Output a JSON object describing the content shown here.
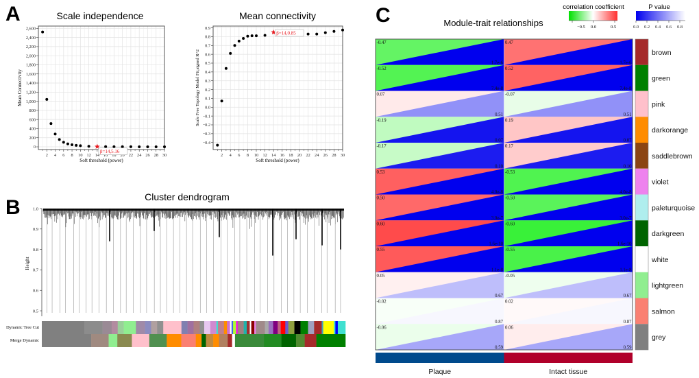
{
  "panels": {
    "a": "A",
    "b": "B",
    "c": "C"
  },
  "chart_data": [
    {
      "type": "scatter",
      "id": "scale-independence",
      "title": "Scale independence",
      "xlabel": "Soft threshold (power)",
      "ylabel": "Mean Connectivity",
      "xlim": [
        0,
        30
      ],
      "ylim": [
        -60,
        2650
      ],
      "xticks": [
        2,
        4,
        6,
        8,
        10,
        12,
        14,
        16,
        18,
        20,
        22,
        24,
        26,
        28,
        30
      ],
      "yticks": [
        0,
        200,
        400,
        600,
        800,
        1000,
        1200,
        1400,
        1600,
        1800,
        2000,
        2200,
        2400,
        2600
      ],
      "ytick_labels": [
        "0",
        "200",
        "400",
        "600",
        "800",
        "1,000",
        "1,200",
        "1,400",
        "1,600",
        "1,800",
        "2,000",
        "2,200",
        "2,400",
        "2,600"
      ],
      "grid": true,
      "x": [
        1,
        2,
        3,
        4,
        5,
        6,
        7,
        8,
        9,
        10,
        12,
        14,
        16,
        18,
        20,
        22,
        24,
        26,
        28,
        30
      ],
      "y": [
        2520,
        1040,
        510,
        280,
        160,
        100,
        65,
        45,
        32,
        25,
        12,
        5.16,
        4,
        3,
        2,
        2,
        1,
        1,
        1,
        1
      ],
      "highlight": {
        "x": 14,
        "y": 5.16,
        "label": "β=14,5.16",
        "color": "#e8191f"
      }
    },
    {
      "type": "scatter",
      "id": "mean-connectivity",
      "title": "Mean connectivity",
      "xlabel": "Soft threshold (power)",
      "ylabel": "Scale Free Topology Model Fit,signed R^2",
      "xlim": [
        0,
        30
      ],
      "ylim": [
        -0.48,
        0.92
      ],
      "xticks": [
        2,
        4,
        6,
        8,
        10,
        12,
        14,
        16,
        18,
        20,
        22,
        24,
        26,
        28,
        30
      ],
      "yticks": [
        -0.4,
        -0.3,
        -0.2,
        -0.1,
        0.0,
        0.1,
        0.2,
        0.3,
        0.4,
        0.5,
        0.6,
        0.7,
        0.8,
        0.9
      ],
      "ytick_labels": [
        "−0.4",
        "−0.3",
        "−0.2",
        "−0.1",
        "0.0",
        "0.1",
        "0.2",
        "0.3",
        "0.4",
        "0.5",
        "0.6",
        "0.7",
        "0.8",
        "0.9"
      ],
      "grid": true,
      "x": [
        1,
        2,
        3,
        4,
        5,
        6,
        7,
        8,
        9,
        10,
        12,
        14,
        16,
        18,
        20,
        22,
        24,
        26,
        28,
        30
      ],
      "y": [
        -0.43,
        0.07,
        0.44,
        0.61,
        0.7,
        0.75,
        0.78,
        0.805,
        0.81,
        0.81,
        0.815,
        0.85,
        0.85,
        0.845,
        0.825,
        0.83,
        0.83,
        0.845,
        0.86,
        0.875
      ],
      "highlight": {
        "x": 14,
        "y": 0.85,
        "label": "β=14,0.85",
        "color": "#e8191f"
      }
    },
    {
      "type": "dendrogram",
      "id": "cluster-dendrogram",
      "title": "Cluster dendrogram",
      "ylabel": "Height",
      "ylim": [
        0.48,
        1.0
      ],
      "yticks": [
        0.5,
        0.6,
        0.7,
        0.8,
        0.9,
        1.0
      ],
      "ytick_labels": [
        "0.5",
        "0.6",
        "0.7",
        "0.8",
        "0.9",
        "1.0"
      ],
      "color_rows": [
        "Dynamic Tree Cut",
        "Merge Dynamic"
      ],
      "dynamic_tree_cut_segments": [
        [
          "#808080",
          0.14
        ],
        [
          "#8c8c8c",
          0.06
        ],
        [
          "#9a8a95",
          0.03
        ],
        [
          "#b28ca0",
          0.02
        ],
        [
          "#9ad09a",
          0.02
        ],
        [
          "#90ee90",
          0.04
        ],
        [
          "#a08aa8",
          0.03
        ],
        [
          "#8c8cc0",
          0.02
        ],
        [
          "#b0a0a0",
          0.02
        ],
        [
          "#909090",
          0.02
        ],
        [
          "#ffc0cb",
          0.06
        ],
        [
          "#8080b0",
          0.02
        ],
        [
          "#a070a0",
          0.02
        ],
        [
          "#b08080",
          0.02
        ],
        [
          "#909090",
          0.015
        ],
        [
          "#e6c8f0",
          0.02
        ],
        [
          "#d08ad0",
          0.02
        ],
        [
          "#40e0d0",
          0.005
        ],
        [
          "#c08090",
          0.02
        ],
        [
          "#ff8c00",
          0.01
        ],
        [
          "#d070d0",
          0.01
        ],
        [
          "#ffffff",
          0.005
        ],
        [
          "#4169e1",
          0.005
        ],
        [
          "#adff2f",
          0.01
        ],
        [
          "#ff00ff",
          0.005
        ],
        [
          "#a08080",
          0.02
        ],
        [
          "#20b2aa",
          0.01
        ],
        [
          "#a03030",
          0.01
        ],
        [
          "#ffffff",
          0.005
        ],
        [
          "#8b0000",
          0.01
        ],
        [
          "#ee82ee",
          0.005
        ],
        [
          "#a08a8a",
          0.03
        ],
        [
          "#a9a9a9",
          0.012
        ],
        [
          "#9a70c0",
          0.015
        ],
        [
          "#800080",
          0.015
        ],
        [
          "#c06080",
          0.01
        ],
        [
          "#ff0000",
          0.015
        ],
        [
          "#6a5acd",
          0.01
        ],
        [
          "#90a040",
          0.02
        ],
        [
          "#000000",
          0.02
        ],
        [
          "#008000",
          0.025
        ],
        [
          "#a0a0c0",
          0.02
        ],
        [
          "#a52a2a",
          0.025
        ],
        [
          "#40a0c0",
          0.005
        ],
        [
          "#ffff00",
          0.035
        ],
        [
          "#40e0d0",
          0.005
        ],
        [
          "#0000ff",
          0.008
        ],
        [
          "#40e0d0",
          0.025
        ]
      ],
      "merge_dynamic_segments": [
        [
          "#808080",
          0.17
        ],
        [
          "#a08a80",
          0.06
        ],
        [
          "#90ee90",
          0.03
        ],
        [
          "#8a8a50",
          0.05
        ],
        [
          "#ffc0cb",
          0.06
        ],
        [
          "#509050",
          0.06
        ],
        [
          "#ff8c00",
          0.05
        ],
        [
          "#fa8072",
          0.05
        ],
        [
          "#ff8c00",
          0.02
        ],
        [
          "#006400",
          0.015
        ],
        [
          "#c08a40",
          0.025
        ],
        [
          "#ff8c00",
          0.02
        ],
        [
          "#b08060",
          0.03
        ],
        [
          "#a52a2a",
          0.015
        ],
        [
          "#ffffff",
          0.01
        ],
        [
          "#3a8a3a",
          0.1
        ],
        [
          "#228b22",
          0.06
        ],
        [
          "#006400",
          0.05
        ],
        [
          "#508a30",
          0.03
        ],
        [
          "#a52a2a",
          0.04
        ],
        [
          "#008000",
          0.1
        ]
      ]
    },
    {
      "type": "heatmap",
      "id": "module-trait-relationships",
      "title": "Module-trait relationships",
      "columns": [
        "Plaque",
        "Intact tissue"
      ],
      "column_colors": [
        "#004a8c",
        "#b0002a"
      ],
      "rows": [
        "brown",
        "green",
        "pink",
        "darkorange",
        "saddlebrown",
        "violet",
        "paleturquoise",
        "darkgreen",
        "white",
        "lightgreen",
        "salmon",
        "grey"
      ],
      "row_colors": [
        "#a52a2a",
        "#008000",
        "#ffc0cb",
        "#ff8c00",
        "#8b4513",
        "#ee82ee",
        "#afeeee",
        "#006400",
        "#ffffff",
        "#90ee90",
        "#fa8072",
        "#808080"
      ],
      "correlation": [
        [
          -0.47,
          0.47
        ],
        [
          -0.52,
          0.52
        ],
        [
          0.07,
          -0.07
        ],
        [
          -0.19,
          0.19
        ],
        [
          -0.17,
          0.17
        ],
        [
          0.53,
          -0.53
        ],
        [
          0.5,
          -0.5
        ],
        [
          0.6,
          -0.6
        ],
        [
          0.55,
          -0.55
        ],
        [
          0.05,
          -0.05
        ],
        [
          -0.02,
          0.02
        ],
        [
          -0.06,
          0.06
        ]
      ],
      "p_value_labels": [
        "1.7e-6",
        "7.4e-8",
        "0.51",
        "0.07",
        "0.10",
        "4.0e-8",
        "3.0e-7",
        "1.6e-10",
        "1.1e-8",
        "0.67",
        "0.87",
        "0.59"
      ],
      "p_values": [
        1.7e-06,
        7.4e-08,
        0.51,
        0.07,
        0.1,
        4e-08,
        3e-07,
        1.6e-10,
        1.1e-08,
        0.67,
        0.87,
        0.59
      ],
      "legend_correlation": {
        "title": "correlation coefficient",
        "ticks": [
          "−0.5",
          "0.0",
          "0.5"
        ],
        "range": [
          -0.65,
          0.65
        ]
      },
      "legend_pvalue": {
        "title": "P value",
        "ticks": [
          "0.0",
          "0.2",
          "0.4",
          "0.6",
          "0.8"
        ],
        "range": [
          0,
          0.9
        ]
      }
    }
  ]
}
